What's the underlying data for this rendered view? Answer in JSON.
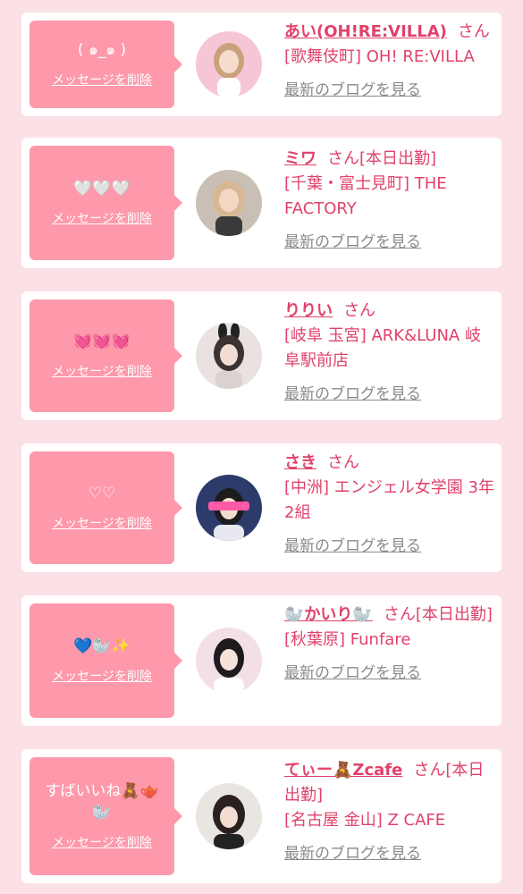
{
  "delete_label": "メッセージを削除",
  "blog_label": "最新のブログを見る",
  "honorific": "さん",
  "items": [
    {
      "message": "( ๑_๑ )",
      "name": "あい(OH!RE:VILLA)",
      "badge": "",
      "shop": "[歌舞伎町] OH! RE:VILLA",
      "avatar": {
        "bg": "#f6c6d6",
        "hair": "#c9a27c"
      }
    },
    {
      "message": "🤍🤍🤍",
      "name": "ミワ",
      "badge": "[本日出勤]",
      "shop": "[千葉・富士見町] THE FACTORY",
      "avatar": {
        "bg": "#c9bfb4",
        "hair": "#d8b894"
      }
    },
    {
      "message": "💓💓💓",
      "name": "りりい",
      "badge": "",
      "shop": "[岐阜 玉宮] ARK&LUNA 岐阜駅前店",
      "avatar": {
        "bg": "#e9e2e0",
        "hair": "#3b3232"
      }
    },
    {
      "message": "♡♡",
      "name": "さき",
      "badge": "",
      "shop": "[中洲] エンジェル女学園 3年2組",
      "avatar": {
        "bg": "#2d3b6b",
        "hair": "#1c1c1c"
      }
    },
    {
      "message": "💙🦭✨",
      "name": "🦭かいり🦭",
      "badge": "[本日出勤]",
      "shop": "[秋葉原] Funfare",
      "avatar": {
        "bg": "#f3dfe8",
        "hair": "#1e1a1e"
      }
    },
    {
      "message": "すばいいね🧸🫖\n🦭",
      "name": "てぃー🧸Zcafe",
      "badge": "[本日出勤]",
      "shop": "[名古屋 金山] Z CAFE",
      "avatar": {
        "bg": "#e9e6e2",
        "hair": "#2a2020"
      }
    }
  ]
}
